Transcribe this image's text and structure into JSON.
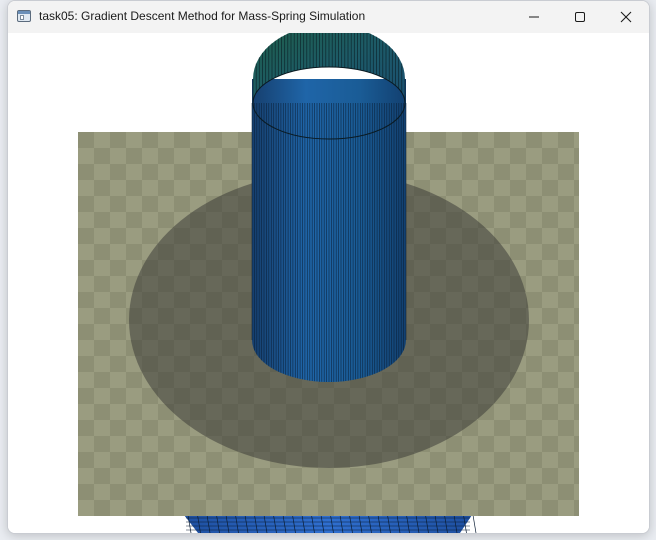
{
  "window": {
    "title": "task05: Gradient Descent Method for Mass-Spring Simulation",
    "icon": "application-window-icon"
  },
  "controls": {
    "minimize_icon": "minimize-icon",
    "maximize_icon": "maximize-icon",
    "close_icon": "close-icon"
  },
  "scene": {
    "background_color": "#ffffff",
    "floor_color_light": "#9a9c80",
    "floor_color_dark": "#8e9076",
    "shadow_color": "#4a4a43",
    "cylinder_color_top": "#1f6a5a",
    "cylinder_color_side": "#1c5fa6",
    "cloth_color": "#2a63b8"
  }
}
